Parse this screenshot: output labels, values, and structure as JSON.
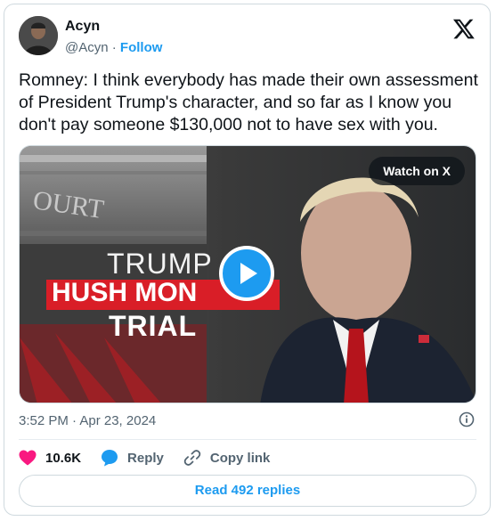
{
  "author": {
    "name": "Acyn",
    "handle": "@Acyn",
    "separator": "·",
    "follow_label": "Follow"
  },
  "tweet": {
    "text": "Romney: I think everybody has made their own assessment of President Trump's character, and so far as I know you don't pay someone $130,000 not to have sex with you.",
    "timestamp": "3:52 PM · Apr 23, 2024"
  },
  "media": {
    "watch_label": "Watch on X",
    "graphic_line1": "TRUMP",
    "graphic_line2": "HUSH MON",
    "graphic_line3": "TRIAL",
    "building_text": "OURT"
  },
  "actions": {
    "likes": "10.6K",
    "reply_label": "Reply",
    "copy_label": "Copy link"
  },
  "footer": {
    "read_replies": "Read 492 replies"
  },
  "colors": {
    "accent": "#1d9bf0",
    "like": "#f91880",
    "muted": "#536471",
    "banner_red": "#d91e27"
  },
  "icons": [
    "x-logo-icon",
    "play-icon",
    "info-icon",
    "heart-icon",
    "reply-bubble-icon",
    "link-icon"
  ]
}
